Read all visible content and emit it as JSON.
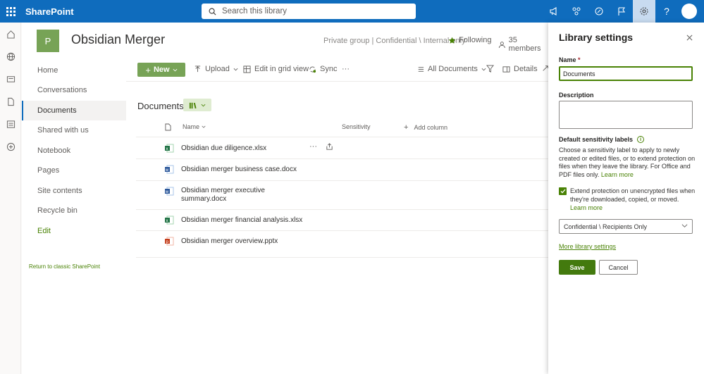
{
  "suite": {
    "brand": "SharePoint",
    "search_placeholder": "Search this library"
  },
  "site": {
    "logo_letter": "P",
    "title": "Obsidian Merger",
    "meta": "Private group | Confidential \\ Internal only",
    "following": "Following",
    "members": "35 members"
  },
  "nav": {
    "items": [
      "Home",
      "Conversations",
      "Documents",
      "Shared with us",
      "Notebook",
      "Pages",
      "Site contents",
      "Recycle bin"
    ],
    "edit": "Edit",
    "return_link": "Return to classic SharePoint",
    "selected": "Documents"
  },
  "commands": {
    "new": "New",
    "upload": "Upload",
    "edit_grid": "Edit in grid view",
    "sync": "Sync",
    "more": "···",
    "view": "All Documents",
    "details": "Details"
  },
  "library": {
    "heading": "Documents",
    "columns": {
      "name": "Name",
      "sensitivity": "Sensitivity",
      "add": "Add column"
    },
    "files": [
      {
        "name": "Obsidian due diligence.xlsx",
        "type": "xlsx"
      },
      {
        "name": "Obsidian merger business case.docx",
        "type": "docx"
      },
      {
        "name": "Obsidian merger executive summary.docx",
        "type": "docx"
      },
      {
        "name": "Obsidian merger financial analysis.xlsx",
        "type": "xlsx"
      },
      {
        "name": "Obsidian merger overview.pptx",
        "type": "pptx"
      }
    ]
  },
  "panel": {
    "title": "Library settings",
    "name_label": "Name",
    "name_required": "*",
    "name_value": "Documents",
    "description_label": "Description",
    "sensitivity_label": "Default sensitivity labels",
    "sensitivity_desc": "Choose a sensitivity label to apply to newly created or edited files, or to extend protection on files when they leave the library. For Office and PDF files only.",
    "learn_more": "Learn more",
    "checkbox_checked": true,
    "checkbox_text": "Extend protection on unencrypted files when they're downloaded, copied, or moved.",
    "dropdown_value": "Confidential \\ Recipients Only",
    "more_settings": "More library settings",
    "save": "Save",
    "cancel": "Cancel"
  },
  "colors": {
    "suite_blue": "#0f6cbd",
    "accent_green": "#498205",
    "save_green": "#437a0e"
  }
}
